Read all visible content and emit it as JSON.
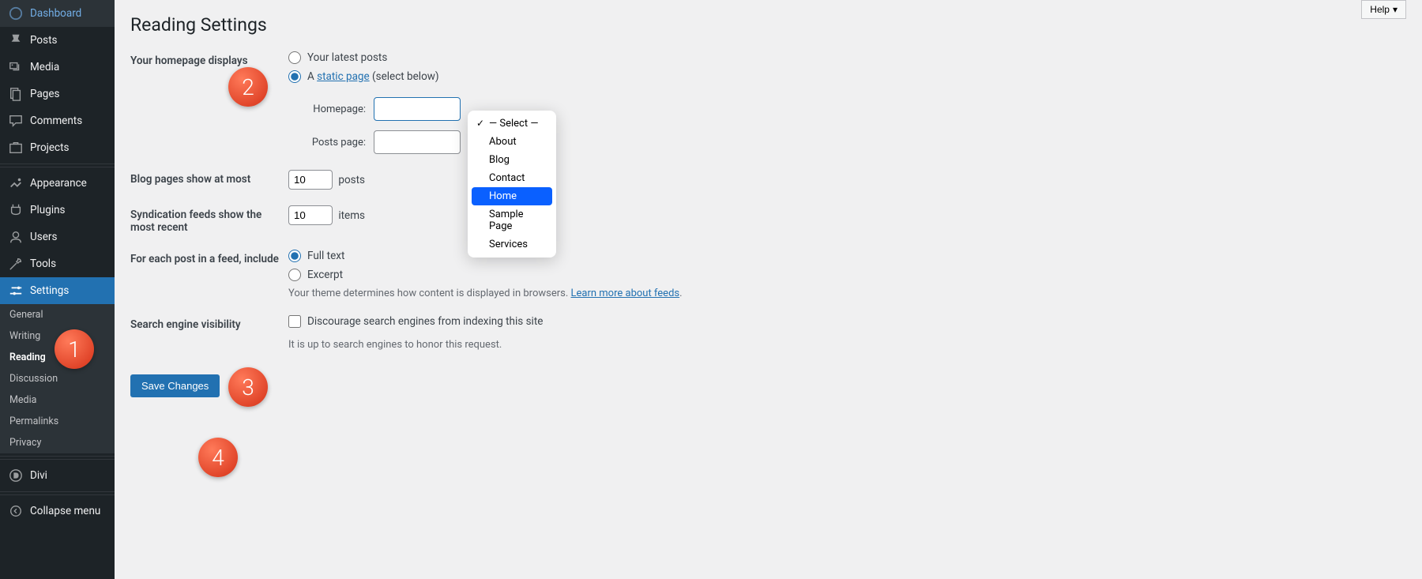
{
  "sidebar": {
    "items": [
      {
        "label": "Dashboard",
        "icon": "dashboard"
      },
      {
        "label": "Posts",
        "icon": "pin"
      },
      {
        "label": "Media",
        "icon": "media"
      },
      {
        "label": "Pages",
        "icon": "pages"
      },
      {
        "label": "Comments",
        "icon": "comments"
      },
      {
        "label": "Projects",
        "icon": "projects"
      },
      {
        "label": "Appearance",
        "icon": "appearance"
      },
      {
        "label": "Plugins",
        "icon": "plugins"
      },
      {
        "label": "Users",
        "icon": "users"
      },
      {
        "label": "Tools",
        "icon": "tools"
      },
      {
        "label": "Settings",
        "icon": "settings"
      }
    ],
    "sub": [
      "General",
      "Writing",
      "Reading",
      "Discussion",
      "Media",
      "Permalinks",
      "Privacy"
    ],
    "sub_active": "Reading",
    "divi": "Divi",
    "collapse": "Collapse menu"
  },
  "help": "Help",
  "page_title": "Reading Settings",
  "homepage": {
    "label": "Your homepage displays",
    "opt_latest": "Your latest posts",
    "opt_static_a": "A ",
    "opt_static_link": "static page",
    "opt_static_b": " (select below)",
    "homepage_lbl": "Homepage:",
    "posts_lbl": "Posts page:"
  },
  "dropdown": {
    "options": [
      "— Select —",
      "About",
      "Blog",
      "Contact",
      "Home",
      "Sample Page",
      "Services"
    ],
    "selected": "— Select —",
    "highlighted": "Home"
  },
  "blog_pages": {
    "label": "Blog pages show at most",
    "value": "10",
    "suffix": "posts"
  },
  "syndication": {
    "label": "Syndication feeds show the most recent",
    "value": "10",
    "suffix": "items"
  },
  "feed_include": {
    "label": "For each post in a feed, include",
    "opt_full": "Full text",
    "opt_excerpt": "Excerpt",
    "desc_a": "Your theme determines how content is displayed in browsers. ",
    "desc_link": "Learn more about feeds",
    "desc_b": "."
  },
  "sev": {
    "label": "Search engine visibility",
    "checkbox": "Discourage search engines from indexing this site",
    "desc": "It is up to search engines to honor this request."
  },
  "save": "Save Changes",
  "badges": {
    "1": "1",
    "2": "2",
    "3": "3",
    "4": "4"
  }
}
